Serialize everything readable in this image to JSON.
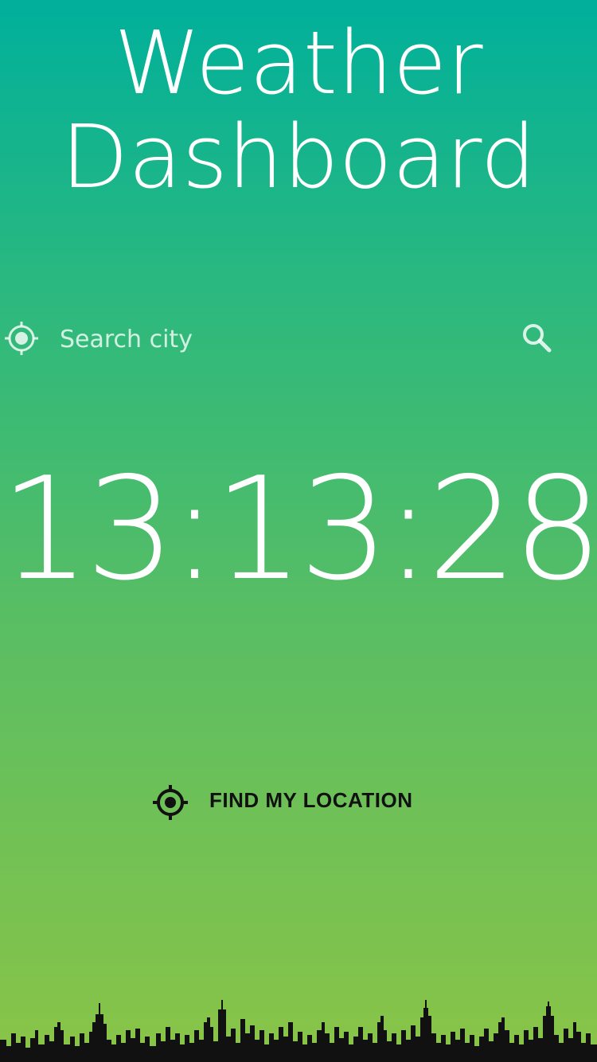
{
  "header": {
    "title_line1": "Weather",
    "title_line2": "Dashboard"
  },
  "search": {
    "placeholder": "Search city",
    "value": "",
    "location_icon": "crosshair-icon",
    "search_icon": "search-icon"
  },
  "clock": {
    "time": "13:13:28"
  },
  "location_button": {
    "label": "FIND MY LOCATION",
    "icon": "gps-target-icon"
  },
  "decor": {
    "skyline": "city-skyline"
  },
  "colors": {
    "gradient_top": "#00b09b",
    "gradient_bottom": "#8ac447",
    "text": "#ffffff",
    "button_text": "#111111"
  }
}
